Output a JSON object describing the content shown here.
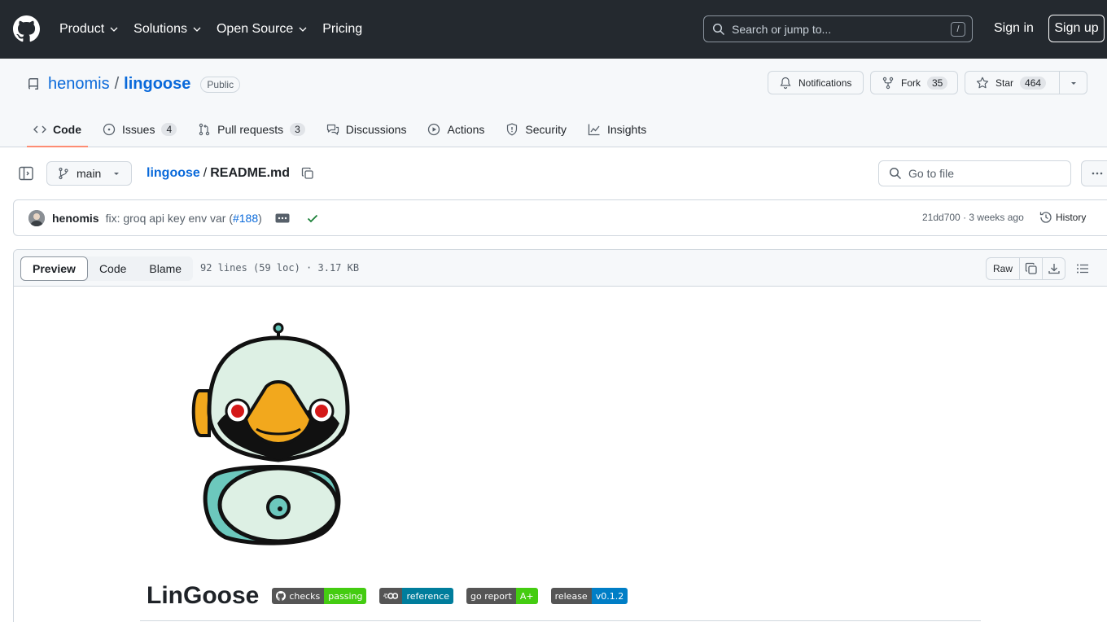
{
  "header": {
    "nav": [
      {
        "label": "Product",
        "dropdown": true
      },
      {
        "label": "Solutions",
        "dropdown": true
      },
      {
        "label": "Open Source",
        "dropdown": true
      },
      {
        "label": "Pricing",
        "dropdown": false
      }
    ],
    "search_placeholder": "Search or jump to...",
    "search_shortcut": "/",
    "sign_in": "Sign in",
    "sign_up": "Sign up"
  },
  "repo": {
    "owner": "henomis",
    "separator": "/",
    "name": "lingoose",
    "visibility": "Public",
    "notifications_label": "Notifications",
    "fork_label": "Fork",
    "fork_count": "35",
    "star_label": "Star",
    "star_count": "464",
    "tabs": [
      {
        "label": "Code",
        "count": null,
        "icon": "code-icon",
        "active": true
      },
      {
        "label": "Issues",
        "count": "4",
        "icon": "issue-icon",
        "active": false
      },
      {
        "label": "Pull requests",
        "count": "3",
        "icon": "pull-request-icon",
        "active": false
      },
      {
        "label": "Discussions",
        "count": null,
        "icon": "discussion-icon",
        "active": false
      },
      {
        "label": "Actions",
        "count": null,
        "icon": "play-icon",
        "active": false
      },
      {
        "label": "Security",
        "count": null,
        "icon": "shield-icon",
        "active": false
      },
      {
        "label": "Insights",
        "count": null,
        "icon": "graph-icon",
        "active": false
      }
    ]
  },
  "file_nav": {
    "branch": "main",
    "path_repo": "lingoose",
    "path_sep": "/",
    "path_file": "README.md",
    "goto_placeholder": "Go to file"
  },
  "commit": {
    "author": "henomis",
    "message_prefix": "fix: groq api key env var (",
    "pr_link": "#188",
    "message_suffix": ")",
    "hash": "21dd700",
    "dot": "·",
    "time": "3 weeks ago",
    "history_label": "History"
  },
  "viewer": {
    "modes": [
      "Preview",
      "Code",
      "Blame"
    ],
    "active_mode": "Preview",
    "info": "92 lines (59 loc) · 3.17 KB",
    "raw_label": "Raw"
  },
  "readme": {
    "emoji": "",
    "title": "LinGoose",
    "badges": [
      {
        "left": "checks",
        "right": "passing",
        "color": "#44cc11",
        "icon": "github-icon"
      },
      {
        "left": "",
        "right": "reference",
        "color": "#007d9c",
        "icon": "go-icon"
      },
      {
        "left": "go report",
        "right": "A+",
        "color": "#44cc11",
        "icon": ""
      },
      {
        "left": "release",
        "right": "v0.1.2",
        "color": "#007ec6",
        "icon": ""
      }
    ]
  }
}
